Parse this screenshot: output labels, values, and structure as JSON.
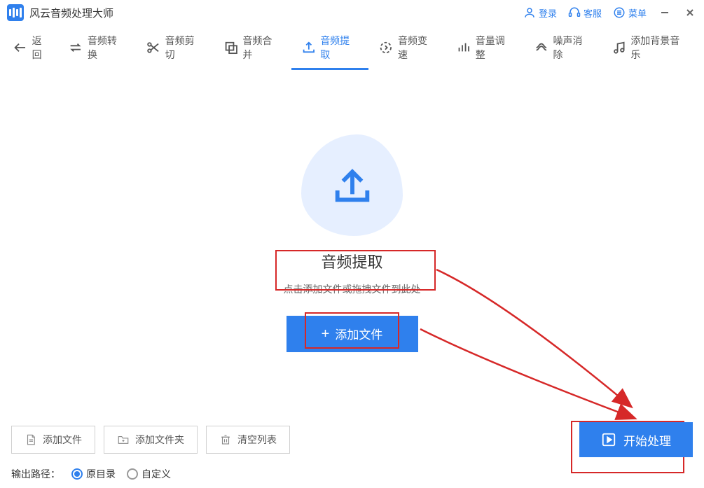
{
  "title_bar": {
    "app_title": "风云音频处理大师",
    "login": "登录",
    "support": "客服",
    "menu": "菜单"
  },
  "tabs": {
    "back": "返回",
    "convert": "音频转换",
    "trim": "音频剪切",
    "merge": "音频合并",
    "extract": "音频提取",
    "speed": "音频变速",
    "volume": "音量调整",
    "noise": "噪声消除",
    "bgm": "添加背景音乐"
  },
  "main": {
    "title": "音频提取",
    "subtitle": "点击添加文件或拖拽文件到此处",
    "add_button": "添加文件"
  },
  "bottom": {
    "add_file": "添加文件",
    "add_folder": "添加文件夹",
    "clear_list": "清空列表",
    "start": "开始处理",
    "output_label": "输出路径：",
    "original_dir": "原目录",
    "custom": "自定义"
  }
}
